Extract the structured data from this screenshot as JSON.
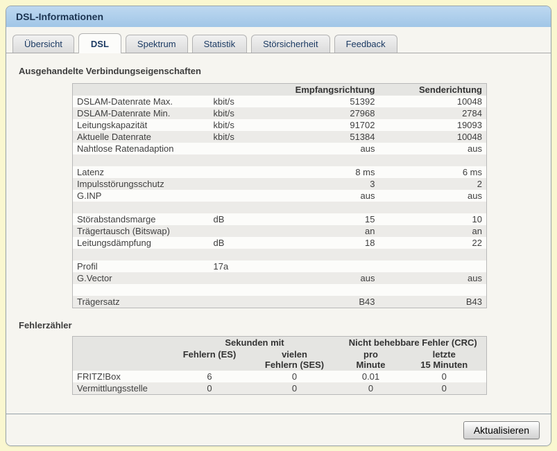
{
  "window": {
    "title": "DSL-Informationen"
  },
  "tabs": [
    {
      "label": "Übersicht",
      "active": false
    },
    {
      "label": "DSL",
      "active": true
    },
    {
      "label": "Spektrum",
      "active": false
    },
    {
      "label": "Statistik",
      "active": false
    },
    {
      "label": "Störsicherheit",
      "active": false
    },
    {
      "label": "Feedback",
      "active": false
    }
  ],
  "connection": {
    "heading": "Ausgehandelte Verbindungseigenschaften",
    "columns": [
      "",
      "",
      "Empfangsrichtung",
      "Senderichtung"
    ],
    "rows": [
      [
        "DSLAM-Datenrate Max.",
        "kbit/s",
        "51392",
        "10048"
      ],
      [
        "DSLAM-Datenrate Min.",
        "kbit/s",
        "27968",
        "2784"
      ],
      [
        "Leitungskapazität",
        "kbit/s",
        "91702",
        "19093"
      ],
      [
        "Aktuelle Datenrate",
        "kbit/s",
        "51384",
        "10048"
      ],
      [
        "Nahtlose Ratenadaption",
        "",
        "aus",
        "aus"
      ],
      [
        "",
        "",
        "",
        ""
      ],
      [
        "Latenz",
        "",
        "8 ms",
        "6 ms"
      ],
      [
        "Impulsstörungsschutz",
        "",
        "3",
        "2"
      ],
      [
        "G.INP",
        "",
        "aus",
        "aus"
      ],
      [
        "",
        "",
        "",
        ""
      ],
      [
        "Störabstandsmarge",
        "dB",
        "15",
        "10"
      ],
      [
        "Trägertausch (Bitswap)",
        "",
        "an",
        "an"
      ],
      [
        "Leitungsdämpfung",
        "dB",
        "18",
        "22"
      ],
      [
        "",
        "",
        "",
        ""
      ],
      [
        "Profil",
        "17a",
        "",
        ""
      ],
      [
        "G.Vector",
        "",
        "aus",
        "aus"
      ],
      [
        "",
        "",
        "",
        ""
      ],
      [
        "Trägersatz",
        "",
        "B43",
        "B43"
      ]
    ]
  },
  "errors": {
    "heading": "Fehlerzähler",
    "group_headers": {
      "seconds": "Sekunden mit",
      "crc": "Nicht behebbare Fehler (CRC)"
    },
    "col_headers": {
      "es": "Fehlern (ES)",
      "ses": "vielen\nFehlern (SES)",
      "per_minute": "pro\nMinute",
      "last15": "letzte\n15 Minuten"
    },
    "rows": [
      [
        "FRITZ!Box",
        "6",
        "0",
        "0.01",
        "0"
      ],
      [
        "Vermittlungsstelle",
        "0",
        "0",
        "0",
        "0"
      ]
    ]
  },
  "footer": {
    "refresh_label": "Aktualisieren"
  },
  "colors": {
    "page_background": "#faf7d0",
    "titlebar_blue": "#a1c6e7",
    "accent_text": "#1b3a63",
    "row_stripe": "#ecebe8"
  }
}
